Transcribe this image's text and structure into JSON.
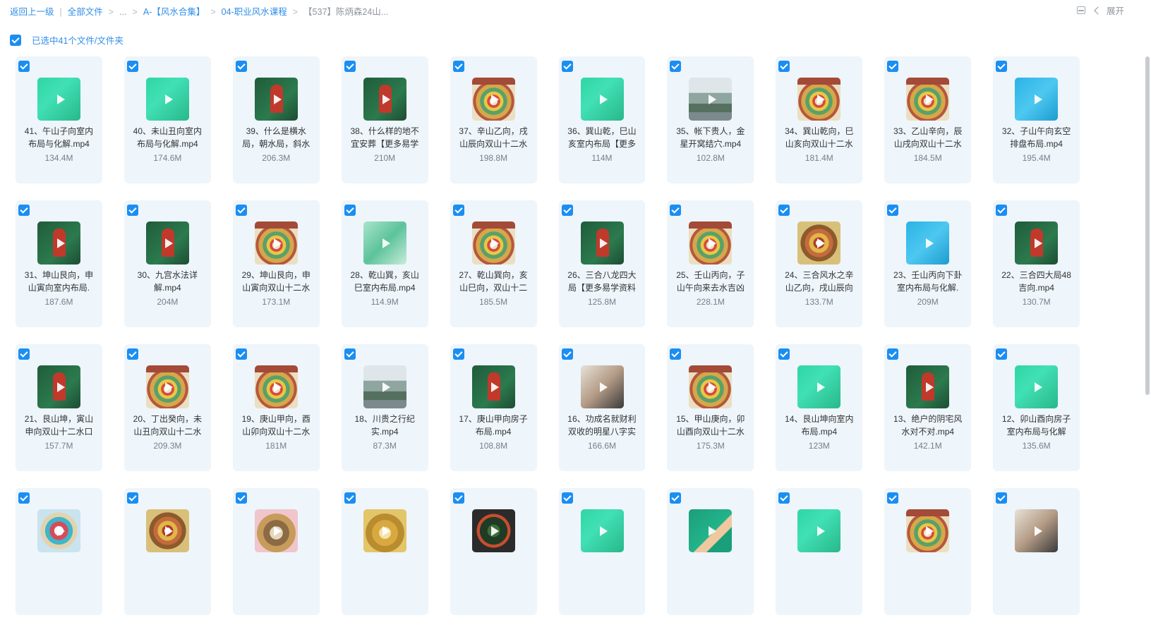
{
  "breadcrumb": {
    "back": "返回上一级",
    "all_files": "全部文件",
    "ellipsis": "...",
    "folder_a": "A-【风水合集】",
    "folder_04": "04-职业风水课程",
    "current": "【537】陈炳森24山..."
  },
  "toolbar": {
    "expand": "展开"
  },
  "selection": {
    "text": "已选中41个文件/文件夹"
  },
  "files": [
    {
      "name": "41、午山子向室内布局与化解.mp4",
      "size": "134.4M",
      "thumb": "green"
    },
    {
      "name": "40、未山丑向室内布局与化解.mp4",
      "size": "174.6M",
      "thumb": "green"
    },
    {
      "name": "39、什么是横水局，朝水局，斜水",
      "size": "206.3M",
      "thumb": "board"
    },
    {
      "name": "38、什么样的地不宜安葬【更多易学",
      "size": "210M",
      "thumb": "board"
    },
    {
      "name": "37、辛山乙向，戌山辰向双山十二水",
      "size": "198.8M",
      "thumb": "compass"
    },
    {
      "name": "36、巽山乾，巳山亥室内布局【更多",
      "size": "114M",
      "thumb": "green"
    },
    {
      "name": "35、帐下贵人，金星开窝结穴.mp4",
      "size": "102.8M",
      "thumb": "land"
    },
    {
      "name": "34、巽山乾向，巳山亥向双山十二水",
      "size": "181.4M",
      "thumb": "compass"
    },
    {
      "name": "33、乙山辛向，辰山戌向双山十二水",
      "size": "184.5M",
      "thumb": "compass"
    },
    {
      "name": "32、子山午向玄空排盘布局.mp4",
      "size": "195.4M",
      "thumb": "blue"
    },
    {
      "name": "31、坤山艮向，申山寅向室内布局.",
      "size": "187.6M",
      "thumb": "board"
    },
    {
      "name": "30、九宫水法详解.mp4",
      "size": "204M",
      "thumb": "board"
    },
    {
      "name": "29、坤山艮向，申山寅向双山十二水",
      "size": "173.1M",
      "thumb": "compass"
    },
    {
      "name": "28、乾山巽，亥山巳室内布局.mp4",
      "size": "114.9M",
      "thumb": "room"
    },
    {
      "name": "27、乾山巽向，亥山巳向，双山十二",
      "size": "185.5M",
      "thumb": "compass"
    },
    {
      "name": "26、三合八龙四大局【更多易学资料",
      "size": "125.8M",
      "thumb": "board"
    },
    {
      "name": "25、壬山丙向，子山午向来去水吉凶",
      "size": "228.1M",
      "thumb": "compass"
    },
    {
      "name": "24、三合风水之辛山乙向，戌山辰向",
      "size": "133.7M",
      "thumb": "compass2"
    },
    {
      "name": "23、壬山丙向下卦室内布局与化解.",
      "size": "209M",
      "thumb": "blue"
    },
    {
      "name": "22、三合四大局48吉向.mp4",
      "size": "130.7M",
      "thumb": "board"
    },
    {
      "name": "21、艮山坤，寅山申向双山十二水口",
      "size": "157.7M",
      "thumb": "board"
    },
    {
      "name": "20、丁出癸向，未山丑向双山十二水",
      "size": "209.3M",
      "thumb": "compass"
    },
    {
      "name": "19、庚山甲向，酉山卯向双山十二水",
      "size": "181M",
      "thumb": "compass"
    },
    {
      "name": "18、川贵之行纪实.mp4",
      "size": "87.3M",
      "thumb": "land"
    },
    {
      "name": "17、庚山甲向房子布局.mp4",
      "size": "108.8M",
      "thumb": "board"
    },
    {
      "name": "16、功成名就财利双收的明星八字实",
      "size": "166.6M",
      "thumb": "person"
    },
    {
      "name": "15、甲山庚向，卯山酉向双山十二水",
      "size": "175.3M",
      "thumb": "compass"
    },
    {
      "name": "14、艮山坤向室内布局.mp4",
      "size": "123M",
      "thumb": "green"
    },
    {
      "name": "13、绝户的阴宅风水对不对.mp4",
      "size": "142.1M",
      "thumb": "board"
    },
    {
      "name": "12、卯山酉向房子室内布局与化解",
      "size": "135.6M",
      "thumb": "green"
    },
    {
      "name": "",
      "size": "",
      "thumb": "mixed"
    },
    {
      "name": "",
      "size": "",
      "thumb": "compass2"
    },
    {
      "name": "",
      "size": "",
      "thumb": "pink"
    },
    {
      "name": "",
      "size": "",
      "thumb": "gold"
    },
    {
      "name": "",
      "size": "",
      "thumb": "dark"
    },
    {
      "name": "",
      "size": "",
      "thumb": "green"
    },
    {
      "name": "",
      "size": "",
      "thumb": "tealman"
    },
    {
      "name": "",
      "size": "",
      "thumb": "green"
    },
    {
      "name": "",
      "size": "",
      "thumb": "compass"
    },
    {
      "name": "",
      "size": "",
      "thumb": "person"
    }
  ]
}
